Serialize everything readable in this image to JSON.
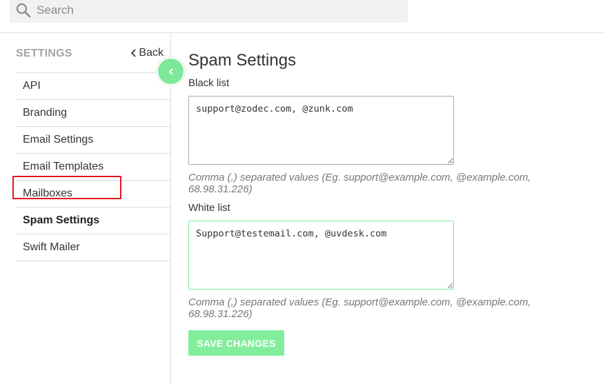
{
  "search": {
    "placeholder": "Search"
  },
  "sidebar": {
    "title": "SETTINGS",
    "back_label": "Back",
    "items": [
      {
        "label": "API"
      },
      {
        "label": "Branding"
      },
      {
        "label": "Email Settings"
      },
      {
        "label": "Email Templates"
      },
      {
        "label": "Mailboxes"
      },
      {
        "label": "Spam Settings",
        "active": true
      },
      {
        "label": "Swift Mailer"
      }
    ]
  },
  "main": {
    "title": "Spam Settings",
    "blacklist": {
      "label": "Black list",
      "value": "support@zodec.com, @zunk.com",
      "hint": "Comma (,) separated values (Eg. support@example.com, @example.com, 68.98.31.226)"
    },
    "whitelist": {
      "label": "White list",
      "value": "Support@testemail.com, @uvdesk.com",
      "hint": "Comma (,) separated values (Eg. support@example.com, @example.com, 68.98.31.226)"
    },
    "save_label": "SAVE CHANGES"
  },
  "colors": {
    "accent": "#7ee89a",
    "highlight": "#e4161b"
  }
}
